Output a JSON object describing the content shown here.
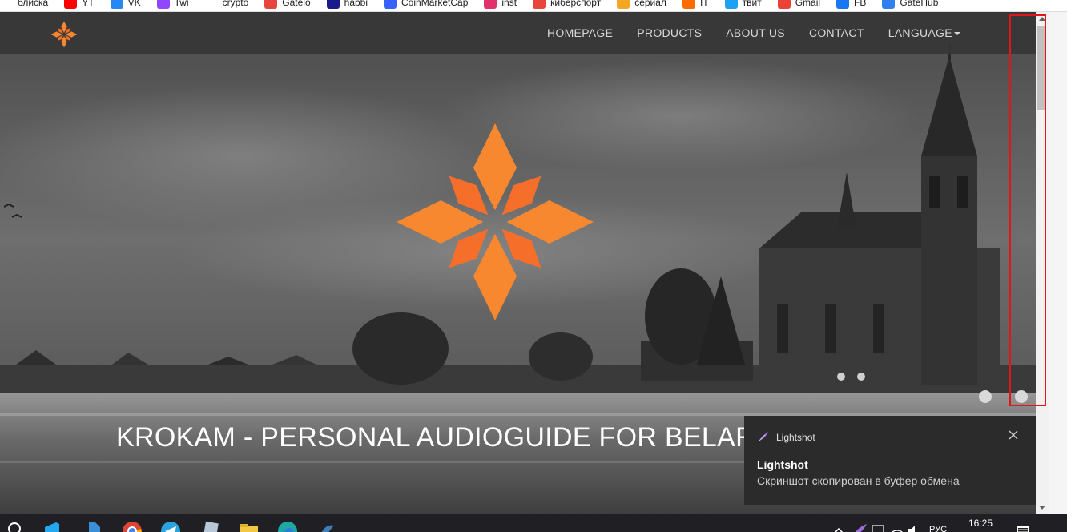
{
  "bookmarks": [
    {
      "label": "блиска",
      "color": "#ffffff",
      "icon": "tab-icon"
    },
    {
      "label": "YT",
      "color": "#ff0000",
      "icon": "youtube-icon"
    },
    {
      "label": "VK",
      "color": "#2787f5",
      "icon": "vk-icon"
    },
    {
      "label": "Twi",
      "color": "#9146ff",
      "icon": "twitch-icon"
    },
    {
      "label": "crypto",
      "color": "#ffffff",
      "icon": "chart-icon"
    },
    {
      "label": "Gatelo",
      "color": "#e8453c",
      "icon": "diamond-icon"
    },
    {
      "label": "habbi",
      "color": "#1a1a8a",
      "icon": "habbi-icon"
    },
    {
      "label": "CoinMarketCap",
      "color": "#3861fb",
      "icon": "coinmarketcap-icon"
    },
    {
      "label": "inst",
      "color": "#e1306c",
      "icon": "instagram-icon"
    },
    {
      "label": "киберспорт",
      "color": "#e8453c",
      "icon": "cyber-icon"
    },
    {
      "label": "сериал",
      "color": "#f5a623",
      "icon": "serial-icon"
    },
    {
      "label": "IT",
      "color": "#ff6a00",
      "icon": "it-icon"
    },
    {
      "label": "твит",
      "color": "#1da1f2",
      "icon": "twitter-icon"
    },
    {
      "label": "Gmail",
      "color": "#ea4335",
      "icon": "gmail-icon"
    },
    {
      "label": "FB",
      "color": "#1877f2",
      "icon": "facebook-icon"
    },
    {
      "label": "GateHub",
      "color": "#2f80ed",
      "icon": "gatehub-icon"
    }
  ],
  "nav": {
    "links": [
      "HOMEPAGE",
      "PRODUCTS",
      "ABOUT US",
      "CONTACT"
    ],
    "language_label": "LANGUAGE",
    "accent": "#f7882f"
  },
  "hero": {
    "title": "KROKAM - PERSONAL AUDIOGUIDE FOR BELARUSIAN CITIES"
  },
  "toast": {
    "app_name": "Lightshot",
    "title": "Lightshot",
    "body": "Скриншот скопирован в буфер обмена"
  },
  "taskbar": {
    "time": "16:25",
    "lang": "РУС",
    "apps": [
      "search-icon",
      "vscode-icon",
      "file-icon",
      "chrome-icon",
      "telegram-icon",
      "notes-icon",
      "explorer-icon",
      "edge-icon",
      "mysql-icon"
    ]
  },
  "colors": {
    "annotation": "#e3151a",
    "toast_bg": "#2b2b2b",
    "navbar_bg": "#373737"
  }
}
